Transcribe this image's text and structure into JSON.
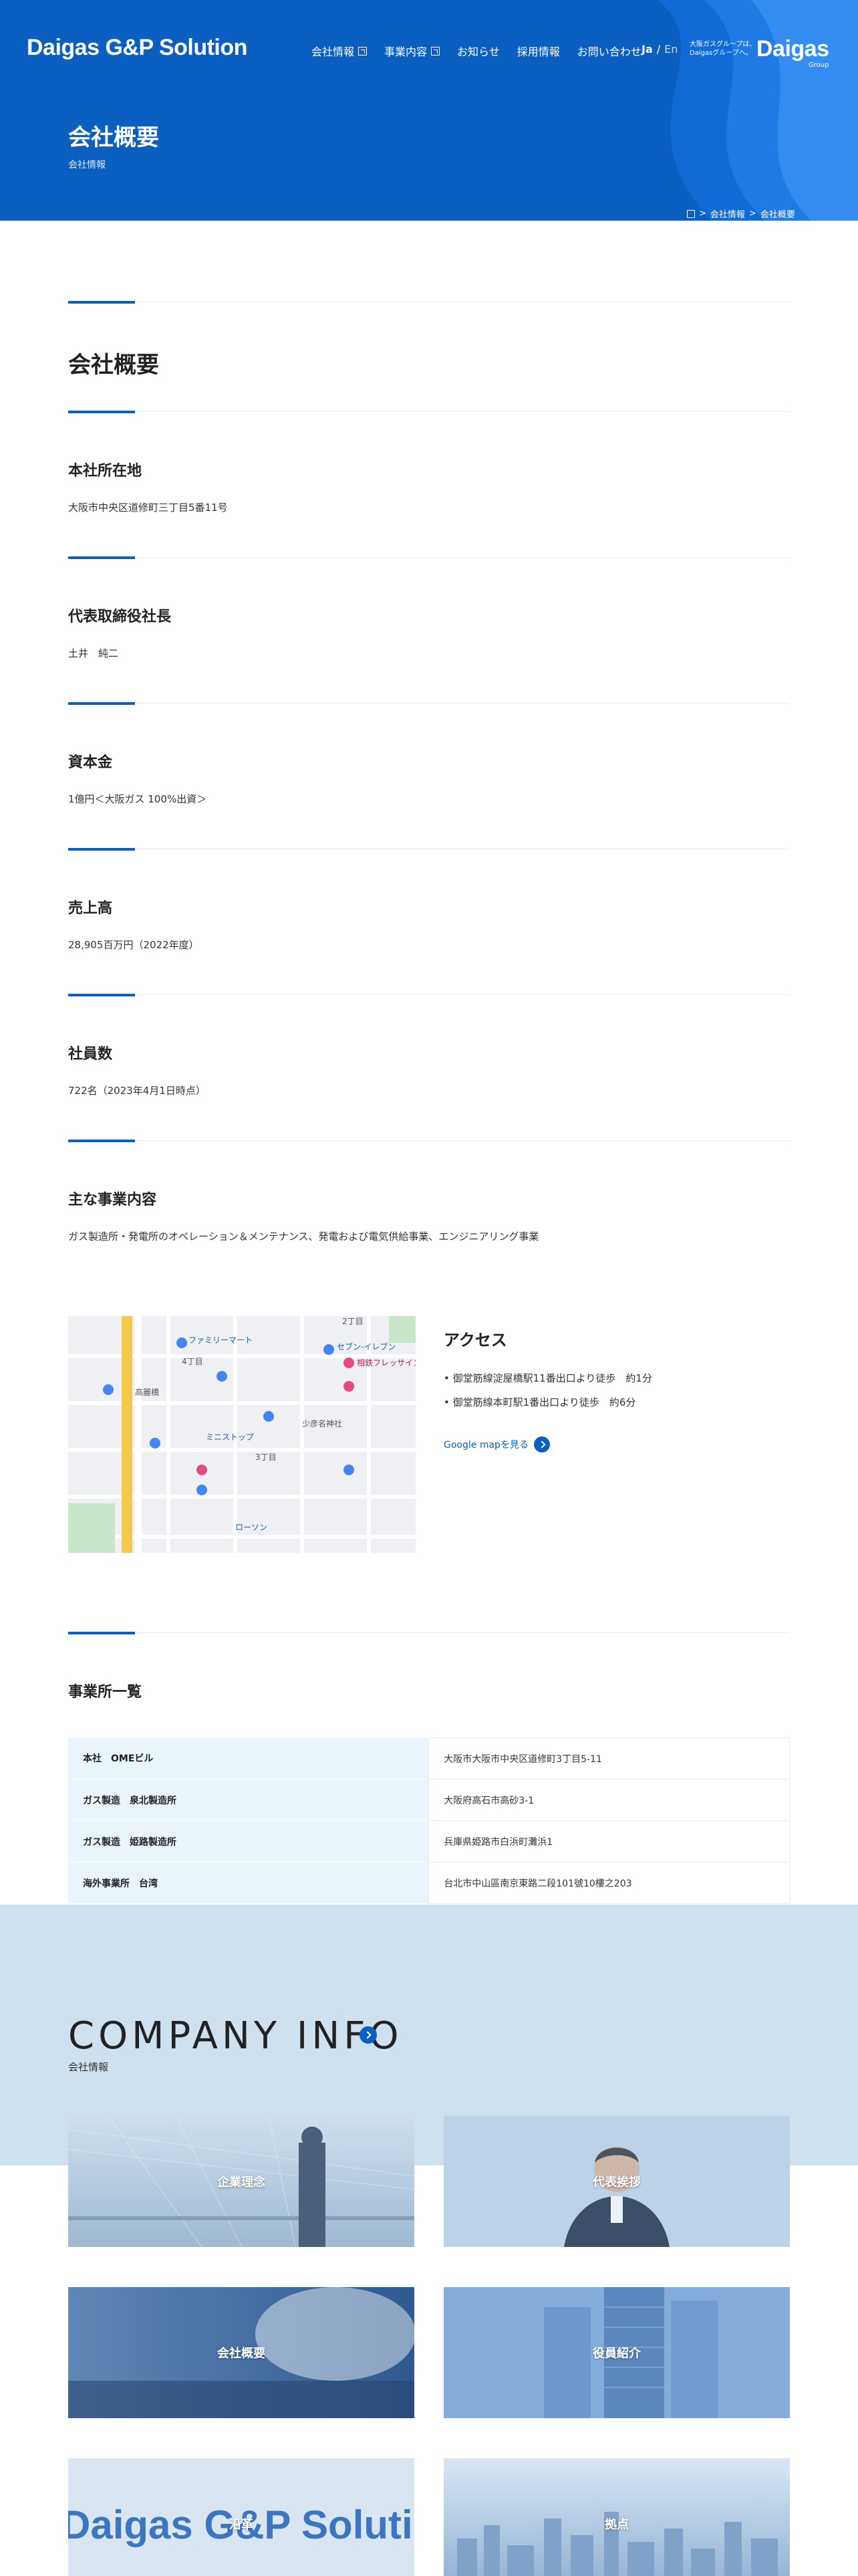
{
  "header": {
    "logo": "Daigas G&P Solution",
    "nav": [
      {
        "label": "会社情報",
        "external": true
      },
      {
        "label": "事業内容",
        "external": true
      },
      {
        "label": "お知らせ",
        "external": false
      },
      {
        "label": "採用情報",
        "external": false
      },
      {
        "label": "お問い合わせ",
        "external": false
      }
    ],
    "lang_ja": "Ja",
    "lang_sep": "/",
    "lang_en": "En",
    "group_tagline_1": "大阪ガスグループは、",
    "group_tagline_2": "Daigasグループへ。",
    "group_logo": "Daigas",
    "group_logo_sub": "Group"
  },
  "hero": {
    "title": "会社概要",
    "subtitle": "会社情報",
    "breadcrumb": [
      "会社情報",
      "会社概要"
    ],
    "breadcrumb_sep": ">"
  },
  "overview": {
    "heading": "会社概要",
    "items": [
      {
        "label": "本社所在地",
        "value": "大阪市中央区道修町三丁目5番11号"
      },
      {
        "label": "代表取締役社長",
        "value": "土井　純二"
      },
      {
        "label": "資本金",
        "value": "1億円＜大阪ガス 100%出資＞"
      },
      {
        "label": "売上高",
        "value": "28,905百万円（2022年度）"
      },
      {
        "label": "社員数",
        "value": "722名（2023年4月1日時点）"
      },
      {
        "label": "主な事業内容",
        "value": "ガス製造所・発電所のオペレーション＆メンテナンス、発電および電気供給事業、エンジニアリング事業"
      }
    ]
  },
  "access": {
    "title": "アクセス",
    "lines": [
      "• 御堂筋線淀屋橋駅11番出口より徒歩　約1分",
      "• 御堂筋線本町駅1番出口より徒歩　約6分"
    ],
    "map_link": "Google mapを見る",
    "map_labels": [
      "ファミリーマート",
      "セブン-イレブン",
      "ローソン",
      "相鉄フレッサイン",
      "少彦名神社",
      "高麗橋",
      "4丁目",
      "3丁目",
      "2丁目",
      "ミニストップ"
    ]
  },
  "offices": {
    "heading": "事業所一覧",
    "rows": [
      {
        "name": "本社　OMEビル",
        "address": "大阪市大阪市中央区道修町3丁目5-11"
      },
      {
        "name": "ガス製造　泉北製造所",
        "address": "大阪府高石市高砂3-1"
      },
      {
        "name": "ガス製造　姫路製造所",
        "address": "兵庫県姫路市白浜町灘浜1"
      },
      {
        "name": "海外事業所　台湾",
        "address": "台北市中山區南京東路二段101號10樓之203"
      }
    ]
  },
  "company_info": {
    "title": "COMPANY INFO",
    "subtitle": "会社情報",
    "cards": [
      {
        "label": "企業理念"
      },
      {
        "label": "代表挨拶"
      },
      {
        "label": "会社概要"
      },
      {
        "label": "役員紹介"
      },
      {
        "label": "沿革"
      },
      {
        "label": "拠点"
      }
    ]
  },
  "colors": {
    "brand_blue": "#0b5fc0",
    "light_band": "#cfe0ef",
    "table_label_bg": "#eaf4fb"
  }
}
